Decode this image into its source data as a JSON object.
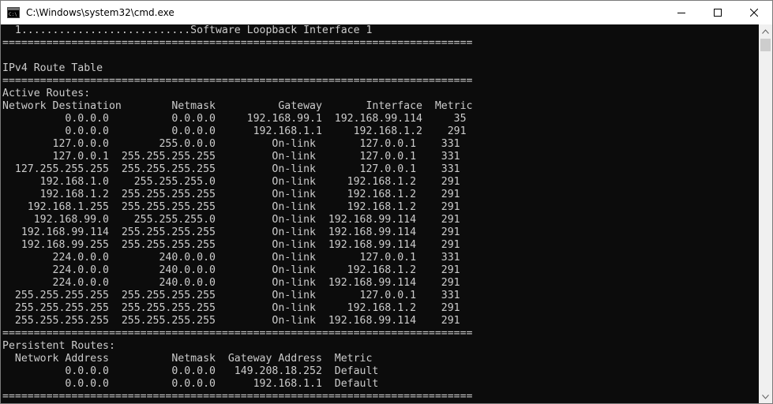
{
  "window": {
    "title": "C:\\Windows\\system32\\cmd.exe",
    "icon": "cmd-icon"
  },
  "controls": {
    "minimize": "minimize-icon",
    "maximize": "maximize-icon",
    "close": "close-icon"
  },
  "console": {
    "lines": [
      "  1...........................Software Loopback Interface 1",
      "===========================================================================",
      "",
      "IPv4 Route Table",
      "===========================================================================",
      "Active Routes:",
      "Network Destination        Netmask          Gateway       Interface  Metric",
      "          0.0.0.0          0.0.0.0     192.168.99.1  192.168.99.114     35",
      "          0.0.0.0          0.0.0.0      192.168.1.1     192.168.1.2    291",
      "        127.0.0.0        255.0.0.0         On-link       127.0.0.1    331",
      "        127.0.0.1  255.255.255.255         On-link       127.0.0.1    331",
      "  127.255.255.255  255.255.255.255         On-link       127.0.0.1    331",
      "      192.168.1.0    255.255.255.0         On-link     192.168.1.2    291",
      "      192.168.1.2  255.255.255.255         On-link     192.168.1.2    291",
      "    192.168.1.255  255.255.255.255         On-link     192.168.1.2    291",
      "     192.168.99.0    255.255.255.0         On-link  192.168.99.114    291",
      "   192.168.99.114  255.255.255.255         On-link  192.168.99.114    291",
      "   192.168.99.255  255.255.255.255         On-link  192.168.99.114    291",
      "        224.0.0.0        240.0.0.0         On-link       127.0.0.1    331",
      "        224.0.0.0        240.0.0.0         On-link     192.168.1.2    291",
      "        224.0.0.0        240.0.0.0         On-link  192.168.99.114    291",
      "  255.255.255.255  255.255.255.255         On-link       127.0.0.1    331",
      "  255.255.255.255  255.255.255.255         On-link     192.168.1.2    291",
      "  255.255.255.255  255.255.255.255         On-link  192.168.99.114    291",
      "===========================================================================",
      "Persistent Routes:",
      "  Network Address          Netmask  Gateway Address  Metric",
      "          0.0.0.0          0.0.0.0   149.208.18.252  Default",
      "          0.0.0.0          0.0.0.0      192.168.1.1  Default",
      "==========================================================================="
    ]
  },
  "colors": {
    "console_bg": "#0c0c0c",
    "console_text": "#cccccc",
    "titlebar_bg": "#ffffff"
  }
}
